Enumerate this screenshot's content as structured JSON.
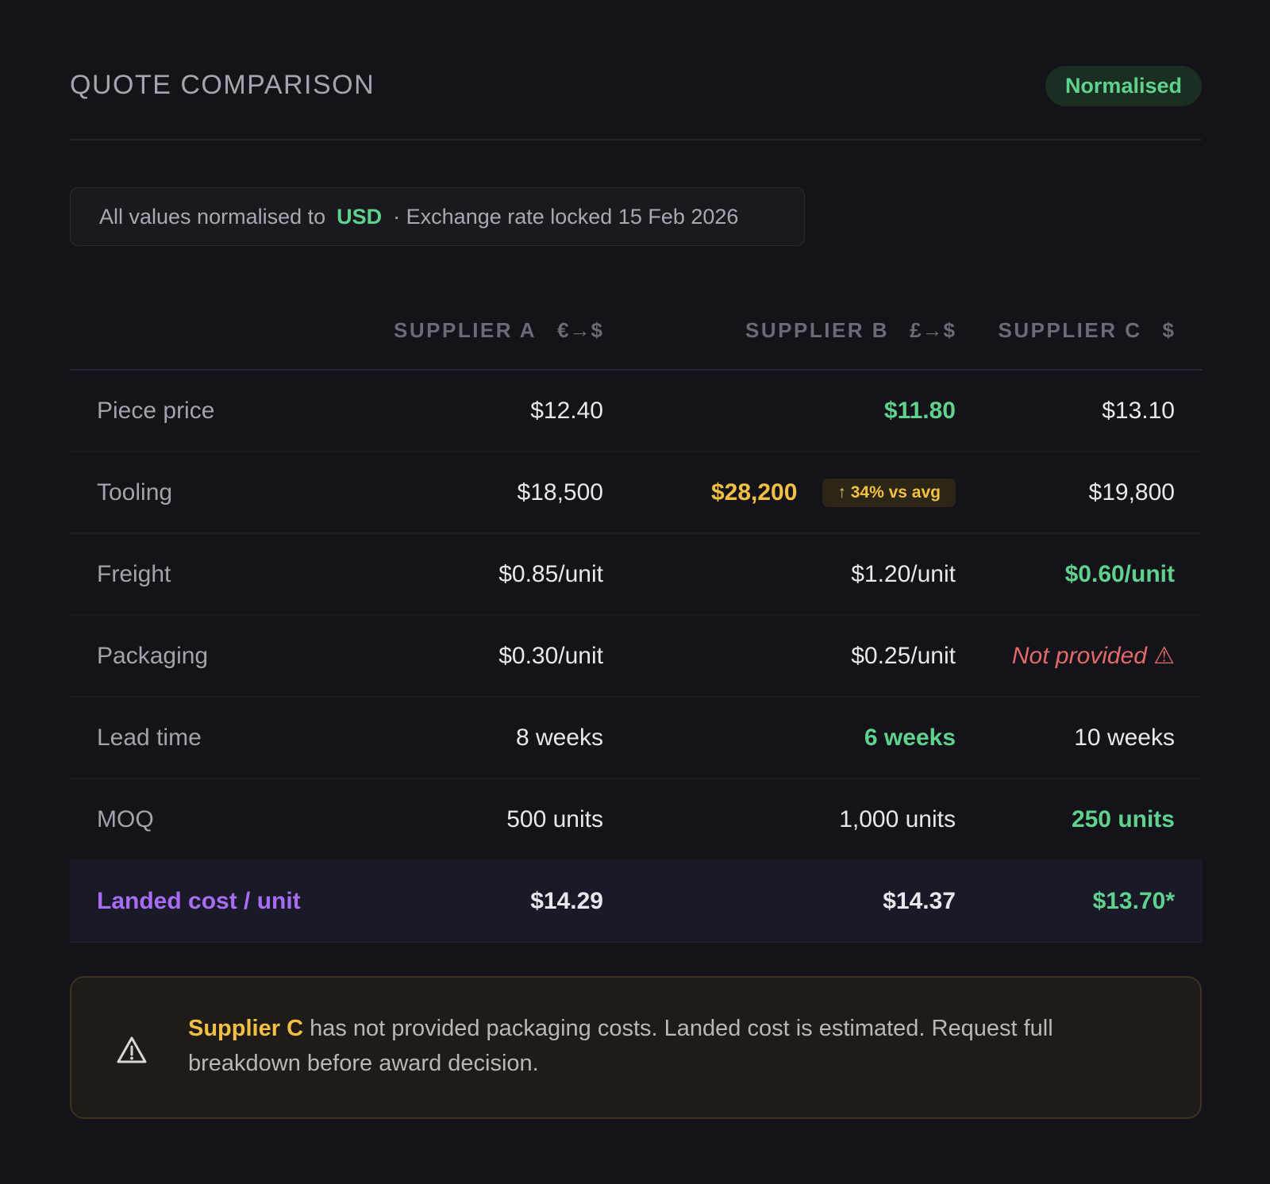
{
  "header": {
    "title": "QUOTE COMPARISON",
    "badge": "Normalised"
  },
  "info": {
    "prefix": "All values normalised to",
    "currency": "USD",
    "suffix": "· Exchange rate locked 15 Feb 2026"
  },
  "columns": [
    {
      "name": "SUPPLIER A",
      "fx": "€→$"
    },
    {
      "name": "SUPPLIER B",
      "fx": "£→$"
    },
    {
      "name": "SUPPLIER C",
      "fx": "$"
    }
  ],
  "rows": [
    {
      "label": "Piece price",
      "a": "$12.40",
      "b": "$11.80",
      "c": "$13.10",
      "best": "b"
    },
    {
      "label": "Tooling",
      "a": "$18,500",
      "b": "$28,200",
      "b_flag": "↑ 34% vs avg",
      "c": "$19,800"
    },
    {
      "label": "Freight",
      "a": "$0.85/unit",
      "b": "$1.20/unit",
      "c": "$0.60/unit",
      "best": "c"
    },
    {
      "label": "Packaging",
      "a": "$0.30/unit",
      "b": "$0.25/unit",
      "c": "Not provided ⚠"
    },
    {
      "label": "Lead time",
      "a": "8 weeks",
      "b": "6 weeks",
      "c": "10 weeks",
      "best": "b"
    },
    {
      "label": "MOQ",
      "a": "500 units",
      "b": "1,000 units",
      "c": "250 units",
      "best": "c"
    },
    {
      "label": "Landed cost / unit",
      "a": "$14.29",
      "b": "$14.37",
      "c": "$13.70*",
      "best": "c"
    }
  ],
  "alert": {
    "icon": "warning-triangle-icon",
    "supplier": "Supplier C",
    "message": " has not provided packaging costs. Landed cost is estimated. Request full breakdown before award decision."
  },
  "colors": {
    "positive": "#5fd38d",
    "warning": "#f3c044",
    "missing": "#e46a6a",
    "accent": "#a96df5"
  }
}
